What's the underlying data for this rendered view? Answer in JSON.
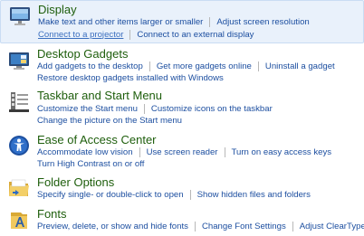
{
  "categories": [
    {
      "id": "display",
      "title": "Display",
      "icon": "display-monitor-icon",
      "rows": [
        [
          "Make text and other items larger or smaller",
          "Adjust screen resolution"
        ],
        [
          "Connect to a projector",
          "Connect to an external display"
        ]
      ]
    },
    {
      "id": "gadgets",
      "title": "Desktop Gadgets",
      "icon": "desktop-gadgets-icon",
      "rows": [
        [
          "Add gadgets to the desktop",
          "Get more gadgets online",
          "Uninstall a gadget"
        ],
        [
          "Restore desktop gadgets installed with Windows"
        ]
      ]
    },
    {
      "id": "taskbar",
      "title": "Taskbar and Start Menu",
      "icon": "taskbar-start-menu-icon",
      "rows": [
        [
          "Customize the Start menu",
          "Customize icons on the taskbar"
        ],
        [
          "Change the picture on the Start menu"
        ]
      ]
    },
    {
      "id": "ease",
      "title": "Ease of Access Center",
      "icon": "ease-of-access-icon",
      "rows": [
        [
          "Accommodate low vision",
          "Use screen reader",
          "Turn on easy access keys"
        ],
        [
          "Turn High Contrast on or off"
        ]
      ]
    },
    {
      "id": "folder",
      "title": "Folder Options",
      "icon": "folder-options-icon",
      "rows": [
        [
          "Specify single- or double-click to open",
          "Show hidden files and folders"
        ]
      ]
    },
    {
      "id": "fonts",
      "title": "Fonts",
      "icon": "fonts-icon",
      "rows": [
        [
          "Preview, delete, or show and hide fonts",
          "Change Font Settings",
          "Adjust ClearType text"
        ]
      ]
    }
  ],
  "highlighted_category": "display",
  "focused_link": "Connect to a projector"
}
